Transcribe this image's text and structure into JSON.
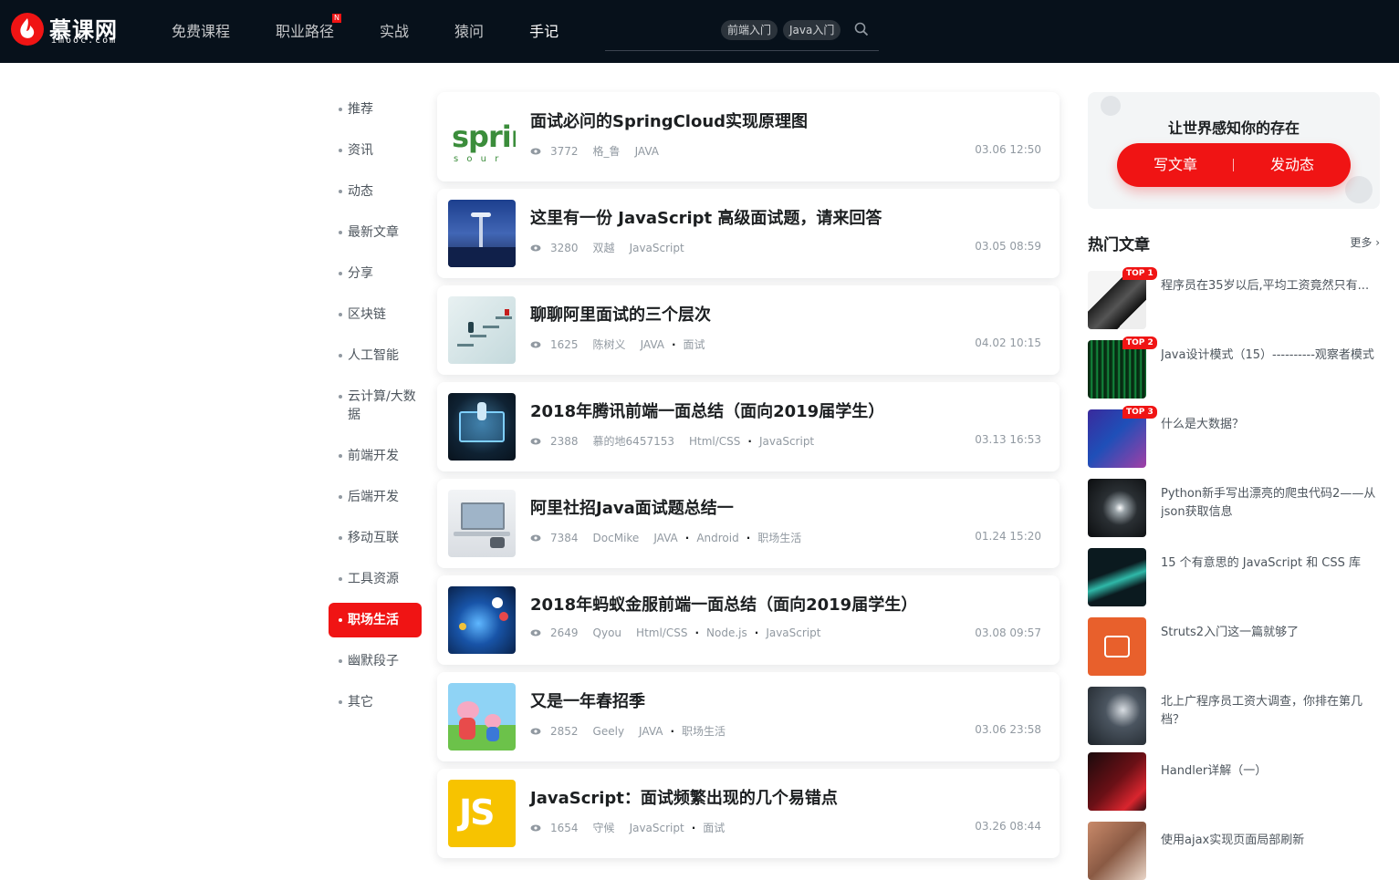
{
  "header": {
    "logo_cn": "慕课网",
    "logo_en": "imooc.com",
    "nav": [
      {
        "label": "免费课程",
        "active": false,
        "badge": ""
      },
      {
        "label": "职业路径",
        "active": false,
        "badge": "N"
      },
      {
        "label": "实战",
        "active": false,
        "badge": ""
      },
      {
        "label": "猿问",
        "active": false,
        "badge": ""
      },
      {
        "label": "手记",
        "active": true,
        "badge": ""
      }
    ],
    "search_tags": [
      "前端入门",
      "Java入门"
    ]
  },
  "categories": [
    {
      "label": "推荐",
      "active": false
    },
    {
      "label": "资讯",
      "active": false
    },
    {
      "label": "动态",
      "active": false
    },
    {
      "label": "最新文章",
      "active": false
    },
    {
      "label": "分享",
      "active": false
    },
    {
      "label": "区块链",
      "active": false
    },
    {
      "label": "人工智能",
      "active": false
    },
    {
      "label": "云计算/大数据",
      "active": false
    },
    {
      "label": "前端开发",
      "active": false
    },
    {
      "label": "后端开发",
      "active": false
    },
    {
      "label": "移动互联",
      "active": false
    },
    {
      "label": "工具资源",
      "active": false
    },
    {
      "label": "职场生活",
      "active": true
    },
    {
      "label": "幽默段子",
      "active": false
    },
    {
      "label": "其它",
      "active": false
    }
  ],
  "articles": [
    {
      "title": "面试必问的SpringCloud实现原理图",
      "views": "3772",
      "author": "格_鲁",
      "tags": [
        "JAVA"
      ],
      "date": "03.06 12:50",
      "thumb_text": "sprir",
      "thumb_sub": "s o u r"
    },
    {
      "title": "这里有一份 JavaScript 高级面试题，请来回答",
      "views": "3280",
      "author": "双越",
      "tags": [
        "JavaScript"
      ],
      "date": "03.05 08:59"
    },
    {
      "title": "聊聊阿里面试的三个层次",
      "views": "1625",
      "author": "陈树义",
      "tags": [
        "JAVA",
        "面试"
      ],
      "date": "04.02 10:15"
    },
    {
      "title": "2018年腾讯前端一面总结（面向2019届学生）",
      "views": "2388",
      "author": "慕的地6457153",
      "tags": [
        "Html/CSS",
        "JavaScript"
      ],
      "date": "03.13 16:53"
    },
    {
      "title": "阿里社招Java面试题总结一",
      "views": "7384",
      "author": "DocMike",
      "tags": [
        "JAVA",
        "Android",
        "职场生活"
      ],
      "date": "01.24 15:20"
    },
    {
      "title": "2018年蚂蚁金服前端一面总结（面向2019届学生）",
      "views": "2649",
      "author": "Qyou",
      "tags": [
        "Html/CSS",
        "Node.js",
        "JavaScript"
      ],
      "date": "03.08 09:57"
    },
    {
      "title": "又是一年春招季",
      "views": "2852",
      "author": "Geely",
      "tags": [
        "JAVA",
        "职场生活"
      ],
      "date": "03.06 23:58"
    },
    {
      "title": "JavaScript：面试频繁出现的几个易错点",
      "views": "1654",
      "author": "守候",
      "tags": [
        "JavaScript",
        "面试"
      ],
      "date": "03.26 08:44",
      "thumb_text": "JS"
    }
  ],
  "write_box": {
    "title": "让世界感知你的存在",
    "write_article": "写文章",
    "post_dynamic": "发动态"
  },
  "hot": {
    "title": "热门文章",
    "more": "更多",
    "items": [
      {
        "text": "程序员在35岁以后,平均工资竟然只有...",
        "badge": "TOP 1"
      },
      {
        "text": "Java设计模式（15）----------观察者模式",
        "badge": "TOP 2"
      },
      {
        "text": "什么是大数据？",
        "badge": "TOP 3"
      },
      {
        "text": "Python新手写出漂亮的爬虫代码2——从json获取信息",
        "badge": ""
      },
      {
        "text": "15 个有意思的 JavaScript 和 CSS 库",
        "badge": ""
      },
      {
        "text": "Struts2入门这一篇就够了",
        "badge": ""
      },
      {
        "text": "北上广程序员工资大调查，你排在第几档？",
        "badge": ""
      },
      {
        "text": "Handler详解（一）",
        "badge": ""
      },
      {
        "text": "使用ajax实现页面局部刷新",
        "badge": ""
      }
    ]
  }
}
